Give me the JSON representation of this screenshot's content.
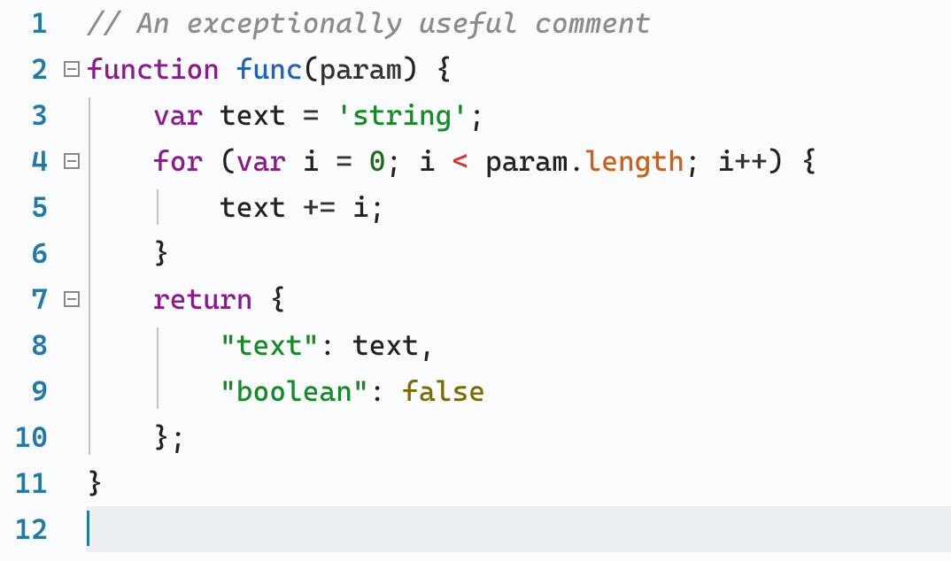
{
  "editor": {
    "language": "javascript",
    "line_count": 12,
    "current_line": 12,
    "fold_markers": {
      "2": "open",
      "4": "open",
      "7": "open"
    },
    "lines": {
      "1": [
        {
          "t": "// An exceptionally useful comment",
          "c": "c-comment"
        }
      ],
      "2": [
        {
          "t": "function",
          "c": "c-kw2"
        },
        {
          "t": " "
        },
        {
          "t": "func",
          "c": "c-fn"
        },
        {
          "t": "("
        },
        {
          "t": "param",
          "c": "c-def"
        },
        {
          "t": ") {"
        }
      ],
      "3": [
        {
          "t": "    "
        },
        {
          "t": "var",
          "c": "c-kw"
        },
        {
          "t": " text "
        },
        {
          "t": "=",
          "c": "c-op"
        },
        {
          "t": " "
        },
        {
          "t": "'string'",
          "c": "c-str"
        },
        {
          "t": ";"
        }
      ],
      "4": [
        {
          "t": "    "
        },
        {
          "t": "for",
          "c": "c-kw"
        },
        {
          "t": " ("
        },
        {
          "t": "var",
          "c": "c-kw"
        },
        {
          "t": " i "
        },
        {
          "t": "=",
          "c": "c-op"
        },
        {
          "t": " "
        },
        {
          "t": "0",
          "c": "c-num"
        },
        {
          "t": "; i "
        },
        {
          "t": "<",
          "c": "c-op-red"
        },
        {
          "t": " param."
        },
        {
          "t": "length",
          "c": "c-prop"
        },
        {
          "t": "; i"
        },
        {
          "t": "++",
          "c": "c-op"
        },
        {
          "t": ") {"
        }
      ],
      "5": [
        {
          "t": "        text "
        },
        {
          "t": "+=",
          "c": "c-op"
        },
        {
          "t": " i;"
        }
      ],
      "6": [
        {
          "t": "    }"
        }
      ],
      "7": [
        {
          "t": "    "
        },
        {
          "t": "return",
          "c": "c-kw"
        },
        {
          "t": " {"
        }
      ],
      "8": [
        {
          "t": "        "
        },
        {
          "t": "\"text\"",
          "c": "c-key"
        },
        {
          "t": ": text,"
        }
      ],
      "9": [
        {
          "t": "        "
        },
        {
          "t": "\"boolean\"",
          "c": "c-key"
        },
        {
          "t": ": "
        },
        {
          "t": "false",
          "c": "c-bool"
        }
      ],
      "10": [
        {
          "t": "    };"
        }
      ],
      "11": [
        {
          "t": "}"
        }
      ],
      "12": []
    },
    "indent_guides": [
      {
        "col": 0,
        "from": 3,
        "to": 10
      },
      {
        "col": 4,
        "from": 5,
        "to": 5
      },
      {
        "col": 4,
        "from": 8,
        "to": 9
      }
    ]
  }
}
